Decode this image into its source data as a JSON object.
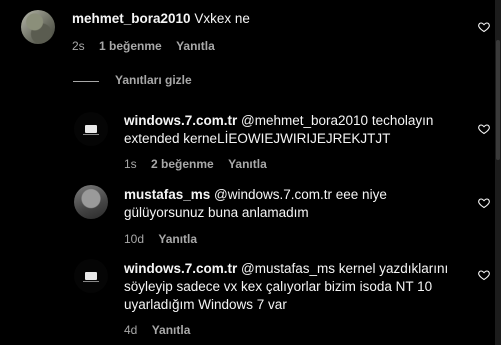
{
  "comments": [
    {
      "user": "mehmet_bora2010",
      "text": " Vxkex ne",
      "time": "2s",
      "likes": "1 beğenme",
      "reply": "Yanıtla"
    }
  ],
  "hide_replies_label": "Yanıtları gizle",
  "replies": [
    {
      "user": "windows.7.com.tr",
      "text": " @mehmet_bora2010 techolayın extended kerneLİEOWIEJWIRIJEJREKJTJT",
      "time": "1s",
      "likes": "2 beğenme",
      "reply": "Yanıtla"
    },
    {
      "user": "mustafas_ms",
      "text": " @windows.7.com.tr eee niye gülüyorsunuz buna anlamadım",
      "time": "10d",
      "reply": "Yanıtla"
    },
    {
      "user": "windows.7.com.tr",
      "text": " @mustafas_ms kernel yazdıklarını söyleyip sadece vx kex çalıyorlar bizim isoda NT 10 uyarladığım Windows 7 var",
      "time": "4d",
      "reply": "Yanıtla"
    }
  ]
}
